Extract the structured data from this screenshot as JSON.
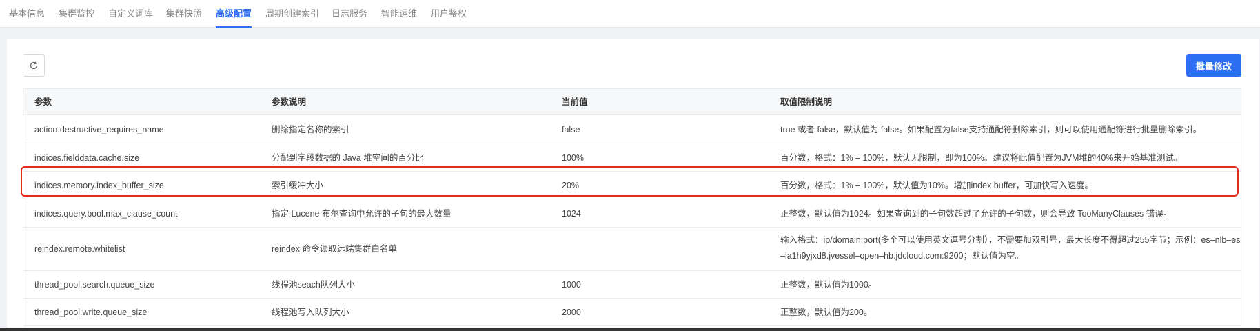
{
  "tabs": [
    "基本信息",
    "集群监控",
    "自定义词库",
    "集群快照",
    "高级配置",
    "周期创建索引",
    "日志服务",
    "智能运维",
    "用户鉴权"
  ],
  "active_tab": "高级配置",
  "toolbar": {
    "refresh_icon": "refresh-icon",
    "batch_edit_label": "批量修改"
  },
  "table": {
    "headers": [
      "参数",
      "参数说明",
      "当前值",
      "取值限制说明"
    ],
    "rows": [
      {
        "param": "action.destructive_requires_name",
        "desc": "删除指定名称的索引",
        "value": "false",
        "limit": "true 或者 false，默认值为 false。如果配置为false支持通配符删除索引，则可以使用通配符进行批量删除索引。"
      },
      {
        "param": "indices.fielddata.cache.size",
        "desc": "分配到字段数据的 Java 堆空间的百分比",
        "value": "100%",
        "limit": "百分数，格式：1% – 100%，默认无限制，即为100%。建议将此值配置为JVM堆的40%来开始基准测试。"
      },
      {
        "param": "indices.memory.index_buffer_size",
        "desc": "索引缓冲大小",
        "value": "20%",
        "limit": "百分数，格式：1% – 100%，默认值为10%。增加index buffer，可加快写入速度。"
      },
      {
        "param": "indices.query.bool.max_clause_count",
        "desc": "指定 Lucene 布尔查询中允许的子句的最大数量",
        "value": "1024",
        "limit": "正整数，默认值为1024。如果查询到的子句数超过了允许的子句数，则会导致 TooManyClauses 错误。"
      },
      {
        "param": "reindex.remote.whitelist",
        "desc": "reindex 命令读取远端集群白名单",
        "value": "",
        "limit_lines": [
          "输入格式：ip/domain:port(多个可以使用英文逗号分割），不需要加双引号，最大长度不得超过255字节；示例：es–nlb–es",
          "–la1h9yjxd8.jvessel–open–hb.jdcloud.com:9200；默认值为空。"
        ]
      },
      {
        "param": "thread_pool.search.queue_size",
        "desc": "线程池seach队列大小",
        "value": "1000",
        "limit": "正整数，默认值为1000。"
      },
      {
        "param": "thread_pool.write.queue_size",
        "desc": "线程池写入队列大小",
        "value": "2000",
        "limit": "正整数，默认值为200。"
      }
    ]
  },
  "colors": {
    "accent": "#2d6ef3",
    "highlight_border": "#e8281e"
  }
}
